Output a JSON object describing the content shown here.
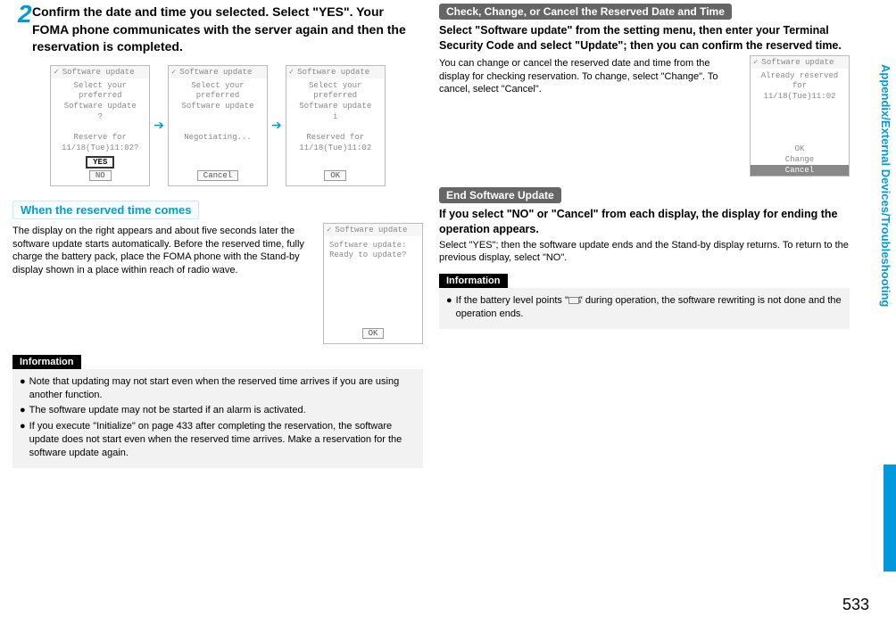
{
  "left": {
    "step_num": "2",
    "step_head": "Confirm the date and time you selected. Select \"YES\".\nYour FOMA phone communicates with the server again and then the reservation is completed.",
    "screens": [
      {
        "title": "Software update",
        "body": "Select your preferred\nSoftware update\n?\n\nReserve for\n11/18(Tue)11:02?",
        "buttons": [
          "YES",
          "NO"
        ],
        "selected": 0
      },
      {
        "title": "Software update",
        "body": "Select your preferred\nSoftware update\n\n\nNegotiating...",
        "buttons": [
          "Cancel"
        ],
        "selected": -1
      },
      {
        "title": "Software update",
        "body": "Select your preferred\nSoftware update\ni\n\nReserved for\n11/18(Tue)11:02",
        "buttons": [
          "OK"
        ],
        "selected": -1
      }
    ],
    "sub1": "When the reserved time comes",
    "sub1_text": "The display on the right appears and about five seconds later the software update starts automatically.\nBefore the reserved time, fully charge the battery pack, place the FOMA phone with the Stand-by display shown in a place within reach of radio wave.",
    "sub1_screen": {
      "title": "Software update",
      "body": "Software update:\nReady to update?",
      "buttons": [
        "OK"
      ],
      "selected": -1
    },
    "info_label": "Information",
    "info_items": [
      "Note that updating may not start even when the reserved time arrives if you are using another function.",
      "The software update may not be started if an alarm is activated.",
      "If you execute \"Initialize\" on page 433 after completing the reservation, the software update does not start even when the reserved time arrives. Make a reservation for the software update again."
    ]
  },
  "right": {
    "head1": "Check, Change, or Cancel the Reserved Date and Time",
    "bold1": "Select \"Software update\" from the setting menu, then enter your Terminal Security Code and select \"Update\"; then you can confirm the reserved time.",
    "para1": "You can change or cancel the reserved date and time from the display for checking reservation. To change, select \"Change\". To cancel, select \"Cancel\".",
    "screen1": {
      "title": "Software update",
      "body": "Already reserved for\n11/18(Tue)11:02",
      "menu": [
        "OK",
        "Change",
        "Cancel"
      ],
      "hl": 2
    },
    "head2": "End Software Update",
    "bold2": "If you select \"NO\" or \"Cancel\" from each display, the display for ending the operation appears.",
    "para2": "Select \"YES\"; then the software update ends and the Stand-by display returns. To return to the previous display, select \"NO\".",
    "info_label": "Information",
    "info_item": "If the battery level points \"   \" during operation, the software rewriting is not done and the operation ends."
  },
  "side_label": "Appendix/External Devices/Troubleshooting",
  "page_num": "533"
}
